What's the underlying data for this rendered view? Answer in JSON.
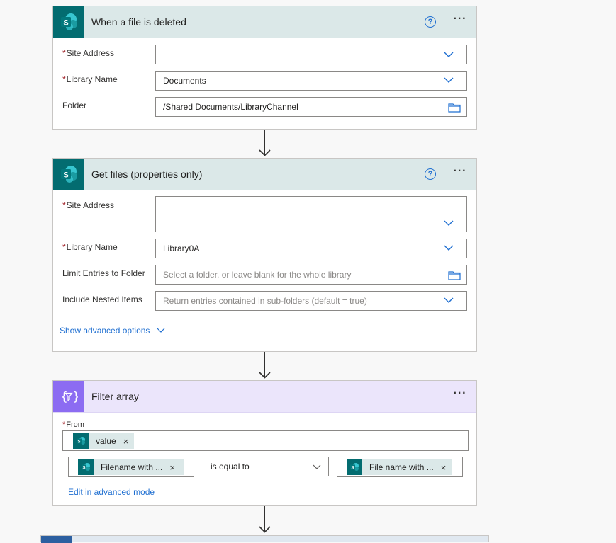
{
  "trigger": {
    "title": "When a file is deleted",
    "help_symbol": "?",
    "more_symbol": "···",
    "icon": "sharepoint-icon",
    "fields": {
      "site_address": {
        "label": "Site Address",
        "required_mark": "*",
        "value": ""
      },
      "library_name": {
        "label": "Library Name",
        "required_mark": "*",
        "value": "Documents"
      },
      "folder": {
        "label": "Folder",
        "value": "/Shared Documents/LibraryChannel"
      }
    }
  },
  "get_files": {
    "title": "Get files (properties only)",
    "help_symbol": "?",
    "more_symbol": "···",
    "icon": "sharepoint-icon",
    "fields": {
      "site_address": {
        "label": "Site Address",
        "required_mark": "*",
        "value": ""
      },
      "library_name": {
        "label": "Library Name",
        "required_mark": "*",
        "value": "Library0A"
      },
      "limit_folder": {
        "label": "Limit Entries to Folder",
        "placeholder": "Select a folder, or leave blank for the whole library"
      },
      "nested": {
        "label": "Include Nested Items",
        "placeholder": "Return entries contained in sub-folders (default = true)"
      }
    },
    "advanced_link": "Show advanced options"
  },
  "filter_array": {
    "title": "Filter array",
    "more_symbol": "···",
    "icon": "filter-array-icon",
    "from": {
      "label": "From",
      "required_mark": "*",
      "token": {
        "label": "value",
        "remove": "×"
      }
    },
    "condition": {
      "left_token": {
        "label": "Filename with ...",
        "remove": "×"
      },
      "operator": "is equal to",
      "right_token": {
        "label": "File name with ...",
        "remove": "×"
      }
    },
    "advanced_link": "Edit in advanced mode"
  },
  "colors": {
    "sharepoint_teal": "#036c70",
    "header_teal": "#dbe8e8",
    "filter_purple": "#8c6cf2",
    "header_purple": "#ebe5fb",
    "link_blue": "#1f6fd1",
    "required_red": "#a4262c"
  }
}
